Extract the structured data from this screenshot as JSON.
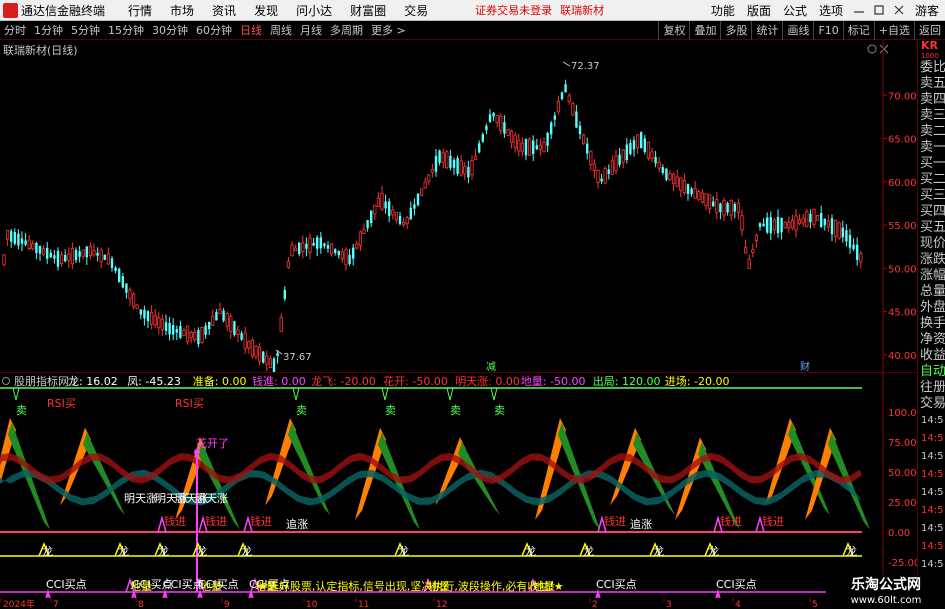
{
  "menubar": {
    "app_title": "通达信金融终端",
    "items": [
      "行情",
      "市场",
      "资讯",
      "发现",
      "问小达",
      "财富圈",
      "交易"
    ],
    "login_text": "证券交易未登录",
    "stock_link": "联瑞新材",
    "right_items": [
      "功能",
      "版面",
      "公式",
      "选项"
    ],
    "guest": "游客"
  },
  "periods": [
    "分时",
    "1分钟",
    "5分钟",
    "15分钟",
    "30分钟",
    "60分钟",
    "日线",
    "周线",
    "月线",
    "多周期",
    "更多"
  ],
  "active_period": "日线",
  "toolbar_right": [
    "复权",
    "叠加",
    "多股",
    "统计",
    "画线",
    "F10",
    "标记",
    "+自选",
    "返回"
  ],
  "price_chart": {
    "title": "联瑞新材(日线)",
    "y_ticks": [
      "70.00",
      "65.00",
      "60.00",
      "55.00",
      "50.00",
      "45.00",
      "40.00"
    ],
    "high_label": "72.37",
    "low_label": "37.67",
    "marker_left": "减",
    "marker_right": "财"
  },
  "indicator": {
    "name": "股朋指标网",
    "params": [
      {
        "label": "龙: 16.02",
        "color": "#ffffff"
      },
      {
        "label": "凤: -45.23",
        "color": "#ffffff"
      },
      {
        "label": "准备: 0.00",
        "color": "#ffff00"
      },
      {
        "label": "钱進: 0.00",
        "color": "#ff40ff"
      },
      {
        "label": "龙飞: -20.00",
        "color": "#ff3030"
      },
      {
        "label": "花开: -50.00",
        "color": "#ff3030"
      },
      {
        "label": "明天涨: 0.00",
        "color": "#ff3030"
      },
      {
        "label": "地量: -50.00",
        "color": "#ff40ff"
      },
      {
        "label": "出局: 120.00",
        "color": "#55ff55"
      },
      {
        "label": "进场: -20.00",
        "color": "#ffff00"
      }
    ],
    "y_ticks": [
      "100.00",
      "75.00",
      "50.00",
      "25.00",
      "0.00",
      "-25.00"
    ],
    "labels": {
      "rsi": "RSI买",
      "sell": "卖",
      "flower": "花开了",
      "tomorrow": "明天涨",
      "qian": "钱进",
      "zhuizhang": "追涨",
      "long": "龙",
      "diliang": "地量",
      "cci": "CCI买点",
      "ticker": "★选好股票,认定指标,信号出现,坚决执行,波段操作,必有收益!★"
    }
  },
  "sidebar": {
    "code": "KR",
    "code_sub": "1000",
    "items": [
      "委比",
      "卖五",
      "卖四",
      "卖三",
      "卖二",
      "卖一",
      "买一",
      "买二",
      "买三",
      "买四",
      "买五",
      "现价",
      "涨跌",
      "涨幅",
      "总量",
      "外盘",
      "换手",
      "净资",
      "收益",
      "自动",
      "往册",
      "交易"
    ],
    "times": [
      "14:5",
      "14:5",
      "14:5",
      "14:5",
      "14:5",
      "14:5",
      "14:5",
      "14:5",
      "14:5"
    ]
  },
  "datebar": {
    "labels": [
      "2024年",
      "7",
      "8",
      "9",
      "10",
      "11",
      "12",
      "2",
      "3",
      "4",
      "5"
    ]
  },
  "watermark": {
    "line1": "乐淘公式网",
    "line2": "www.60lt.com"
  },
  "colors": {
    "up": "#ff3232",
    "down": "#54ffff",
    "accent": "#ff5050",
    "green": "#55ff55",
    "orange": "#ff7f00",
    "darkgreen": "#008040"
  }
}
